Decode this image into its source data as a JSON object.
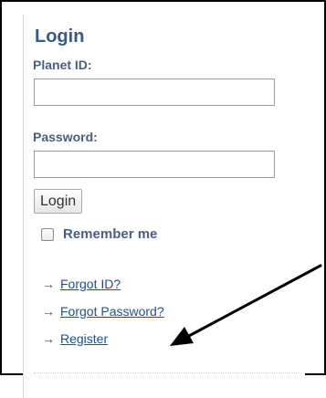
{
  "login": {
    "title": "Login",
    "planet_id_label": "Planet ID:",
    "planet_id_value": "",
    "password_label": "Password:",
    "password_value": "",
    "login_button": "Login",
    "remember_label": "Remember me",
    "remember_checked": false
  },
  "links": [
    {
      "arrow": "→",
      "label": "Forgot ID?"
    },
    {
      "arrow": "→",
      "label": "Forgot Password?"
    },
    {
      "arrow": "→",
      "label": "Register"
    }
  ],
  "annotation": {
    "icon": "pointer-arrow-icon",
    "color": "#000000",
    "points_to": "Register"
  }
}
